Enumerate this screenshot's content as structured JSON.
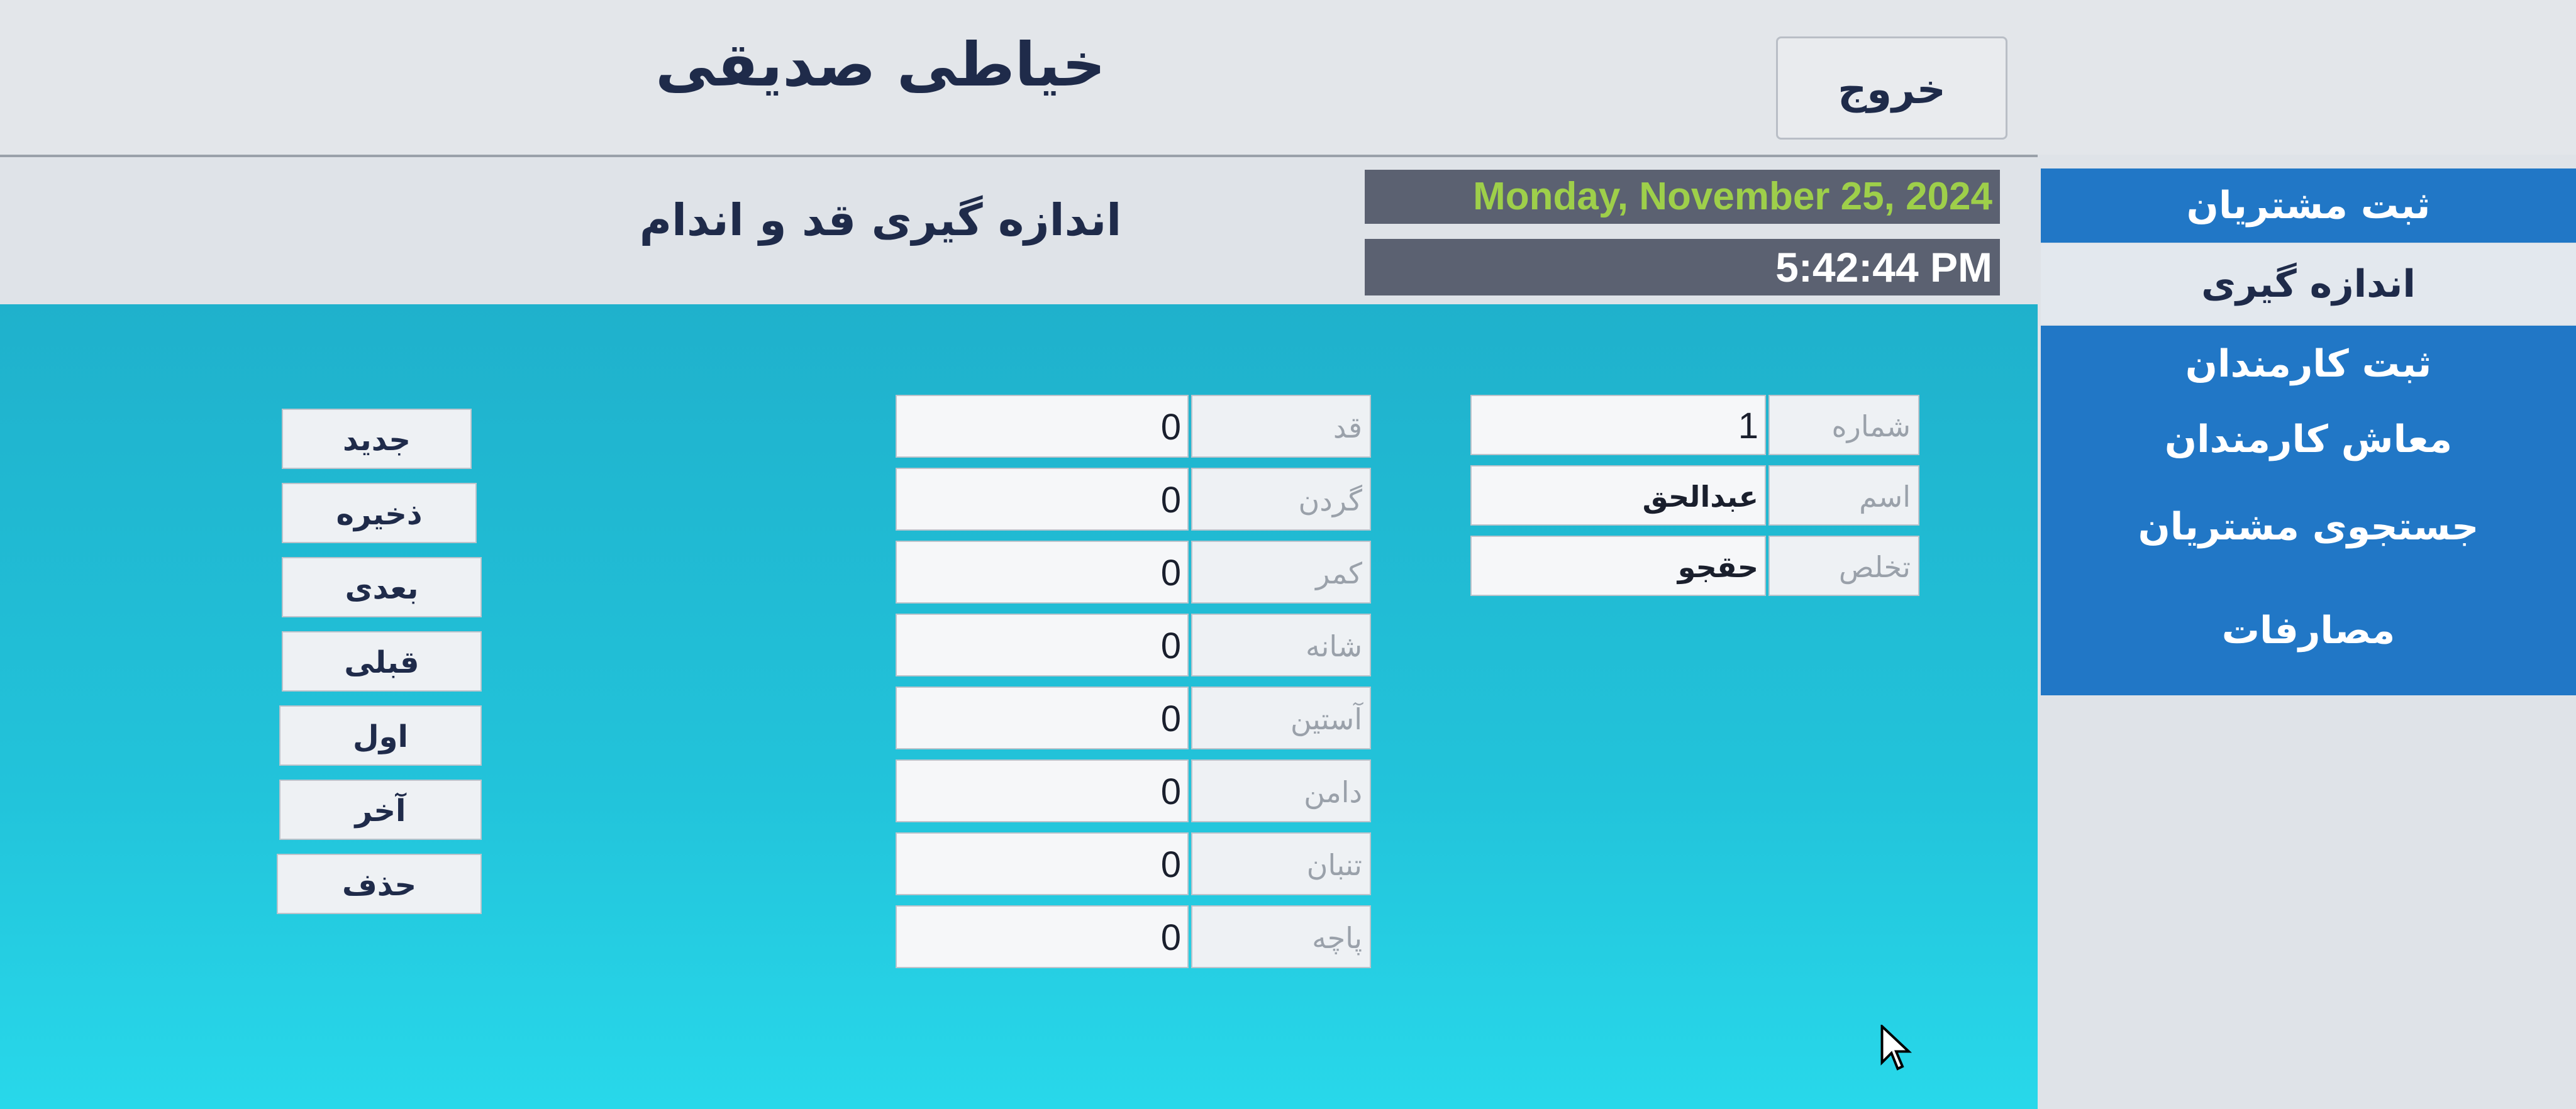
{
  "app": {
    "title": "خیاطی صدیقی",
    "exit_label": "خروج"
  },
  "page": {
    "title": "اندازه گیری قد و اندام"
  },
  "clock": {
    "date": "Monday, November 25, 2024",
    "time": "5:42:44 PM"
  },
  "sidebar": {
    "items": [
      {
        "label": "ثبت مشتریان"
      },
      {
        "label": "اندازه گیری"
      },
      {
        "label": "ثبت کارمندان"
      },
      {
        "label": "معاش کارمندان"
      },
      {
        "label": "جستجوی مشتریان"
      },
      {
        "label": "مصارفات"
      }
    ]
  },
  "customer": {
    "fields": [
      {
        "label": "شماره",
        "value": "1"
      },
      {
        "label": "اسم",
        "value": "عبدالحق"
      },
      {
        "label": "تخلص",
        "value": "حقجو"
      }
    ]
  },
  "measurements": {
    "fields": [
      {
        "label": "قد",
        "value": "0"
      },
      {
        "label": "گردن",
        "value": "0"
      },
      {
        "label": "کمر",
        "value": "0"
      },
      {
        "label": "شانه",
        "value": "0"
      },
      {
        "label": "آستین",
        "value": "0"
      },
      {
        "label": "دامن",
        "value": "0"
      },
      {
        "label": "تنبان",
        "value": "0"
      },
      {
        "label": "پاچه",
        "value": "0"
      }
    ]
  },
  "actions": {
    "buttons": [
      {
        "label": "جدید"
      },
      {
        "label": "ذخیره"
      },
      {
        "label": "بعدی"
      },
      {
        "label": "قبلی"
      },
      {
        "label": "اول"
      },
      {
        "label": "آخر"
      },
      {
        "label": "حذف"
      }
    ]
  }
}
